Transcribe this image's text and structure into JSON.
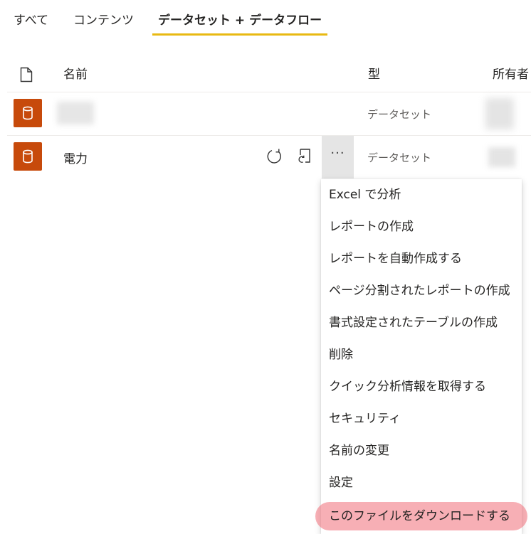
{
  "tabs": {
    "all": "すべて",
    "content": "コンテンツ",
    "datasets_dataflows": "データセット + データフロー"
  },
  "table": {
    "headers": {
      "icon": "file-icon",
      "name": "名前",
      "type": "型",
      "owner": "所有者"
    },
    "rows": [
      {
        "name": "",
        "type": "データセット",
        "icon": "database-icon"
      },
      {
        "name": "電力",
        "type": "データセット",
        "icon": "database-icon"
      }
    ]
  },
  "actions": {
    "more_label": "···"
  },
  "context_menu": {
    "items": [
      "Excel で分析",
      "レポートの作成",
      "レポートを自動作成する",
      "ページ分割されたレポートの作成",
      "書式設定されたテーブルの作成",
      "削除",
      "クイック分析情報を取得する",
      "セキュリティ",
      "名前の変更",
      "設定",
      "このファイルをダウンロードする"
    ]
  },
  "colors": {
    "accent_underline": "#e8b912",
    "dataset_icon_bg": "#c74a0b",
    "highlight": "#f06e78"
  }
}
